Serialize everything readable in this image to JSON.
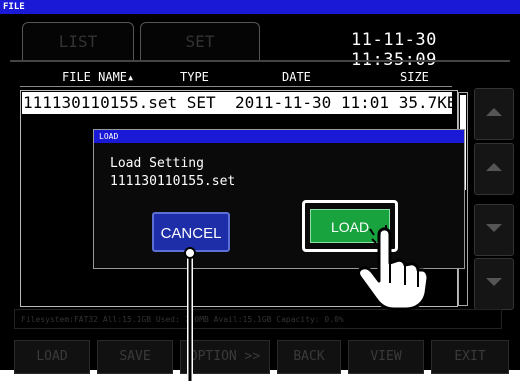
{
  "window": {
    "title": "FILE"
  },
  "tabs": [
    {
      "label": "LIST"
    },
    {
      "label": "SET"
    }
  ],
  "clock": "11-11-30 11:35:09",
  "list": {
    "columns": [
      "FILE NAME▴",
      "TYPE",
      "DATE",
      "SIZE"
    ],
    "rows": [
      {
        "name": "111130110155.set",
        "type": "SET",
        "date": "2011-11-30 11:01",
        "size": "35.7KB"
      }
    ]
  },
  "side_buttons": [
    {
      "icon": "arrow-up-icon"
    },
    {
      "icon": "page-up-icon"
    },
    {
      "icon": "page-down-icon"
    },
    {
      "icon": "arrow-down-icon"
    }
  ],
  "status": "Filesystem:FAT32 All:15.1GB Used: 7.0MB Avail:15.1GB Capacity: 0.0%",
  "bottom_buttons": [
    {
      "label": "LOAD"
    },
    {
      "label": "SAVE"
    },
    {
      "label": "OPTION >>"
    },
    {
      "label": "BACK"
    },
    {
      "label": "VIEW"
    },
    {
      "label": "EXIT"
    }
  ],
  "dialog": {
    "title": "LOAD",
    "line1": "Load Setting",
    "line2": "111130110155.set",
    "cancel_label": "CANCEL",
    "load_label": "LOAD"
  },
  "colors": {
    "title_bar": "#1a1ad6",
    "cancel": "#1e2ea8",
    "load": "#18a33f"
  }
}
